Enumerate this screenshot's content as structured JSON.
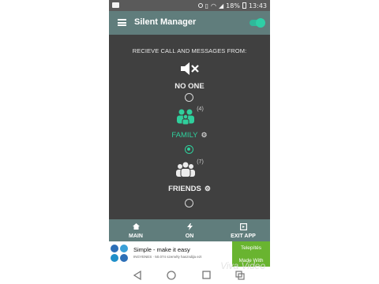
{
  "status_bar": {
    "battery_percent": "18%",
    "time": "13:43"
  },
  "app_bar": {
    "title": "Silent Manager",
    "toggle_on": true
  },
  "content": {
    "heading": "RECIEVE CALL AND MESSAGES FROM:",
    "options": [
      {
        "label": "NO ONE",
        "icon": "mute-icon",
        "count": "",
        "settings": false,
        "selected": false
      },
      {
        "label": "FAMILY",
        "icon": "family-group-icon",
        "count": "(4)",
        "settings": true,
        "selected": true
      },
      {
        "label": "FRIENDS",
        "icon": "friends-group-icon",
        "count": "(7)",
        "settings": true,
        "selected": false
      }
    ]
  },
  "bottom_nav": {
    "items": [
      {
        "label": "MAIN",
        "icon": "home-icon"
      },
      {
        "label": "ON",
        "icon": "bolt-icon"
      },
      {
        "label": "EXIT APP",
        "icon": "exit-icon"
      }
    ]
  },
  "ad": {
    "title": "Simple - make it easy",
    "subtitle": "INGYENES · 50.074 személy használja ezt",
    "button_line1": "Telepítés",
    "button_line2": "Made With"
  },
  "watermark": "Viva Video",
  "colors": {
    "accent": "#2fcf9c",
    "appbar": "#607d7c",
    "background": "#404040",
    "ad_button": "#69b430"
  }
}
